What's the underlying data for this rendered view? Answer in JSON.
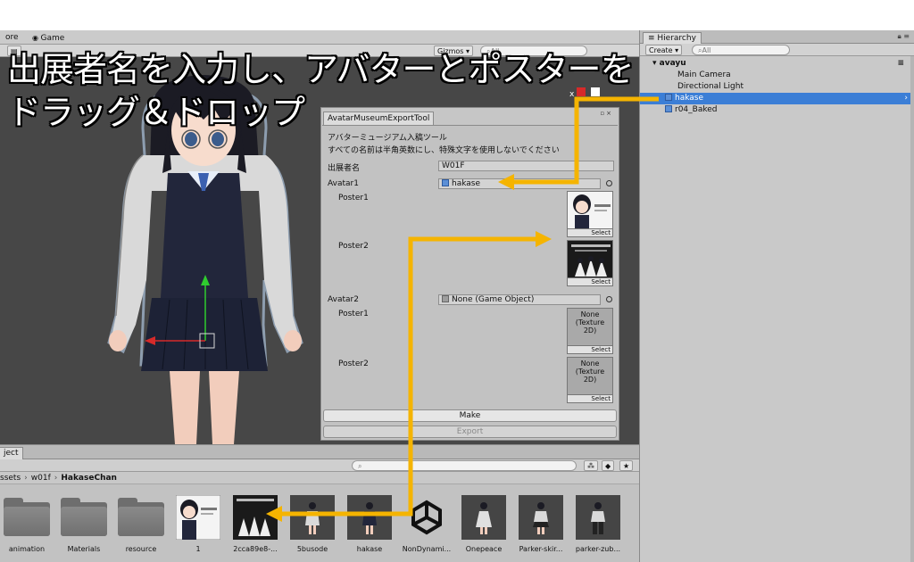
{
  "scene": {
    "tab_more": "ore",
    "tab_game": "Game",
    "gizmos_label": "Gizmos ▾",
    "search_placeholder": "All"
  },
  "caption": {
    "line1": "出展者名を入力し、アバターとポスターを",
    "line2": "ドラッグ＆ドロップ"
  },
  "tool": {
    "title": "AvatarMuseumExportTool",
    "heading": "アバターミュージアム入稿ツール",
    "note": "すべての名前は半角英数にし、特殊文字を使用しないでください",
    "exhibitor_label": "出展者名",
    "exhibitor_value": "W01F",
    "avatar1_label": "Avatar1",
    "avatar1_value": "hakase",
    "avatar1_poster1_label": "Poster1",
    "avatar1_poster2_label": "Poster2",
    "avatar2_label": "Avatar2",
    "avatar2_value": "None (Game Object)",
    "avatar2_poster1_label": "Poster1",
    "avatar2_poster2_label": "Poster2",
    "none_texture": "None\n(Texture\n2D)",
    "select_label": "Select",
    "make_button": "Make",
    "export_button": "Export"
  },
  "hierarchy": {
    "tab": "Hierarchy",
    "create_label": "Create ▾",
    "search_placeholder": "All",
    "scene_name": "avayu",
    "items": [
      {
        "label": "Main Camera"
      },
      {
        "label": "Directional Light"
      },
      {
        "label": "hakase"
      },
      {
        "label": "r04_Baked"
      }
    ]
  },
  "project": {
    "tab": "ject",
    "breadcrumbs": [
      "ssets",
      "w01f",
      "HakaseChan"
    ],
    "assets": [
      {
        "label": "animation"
      },
      {
        "label": "Materials"
      },
      {
        "label": "resource"
      },
      {
        "label": "1"
      },
      {
        "label": "2cca89e8-..."
      },
      {
        "label": "5busode"
      },
      {
        "label": "hakase"
      },
      {
        "label": "NonDynami..."
      },
      {
        "label": "Onepeace"
      },
      {
        "label": "Parker-skir..."
      },
      {
        "label": "parker-zub..."
      }
    ]
  },
  "colors": {
    "accent_arrow": "#f5b400",
    "selection": "#3b7ed6"
  }
}
